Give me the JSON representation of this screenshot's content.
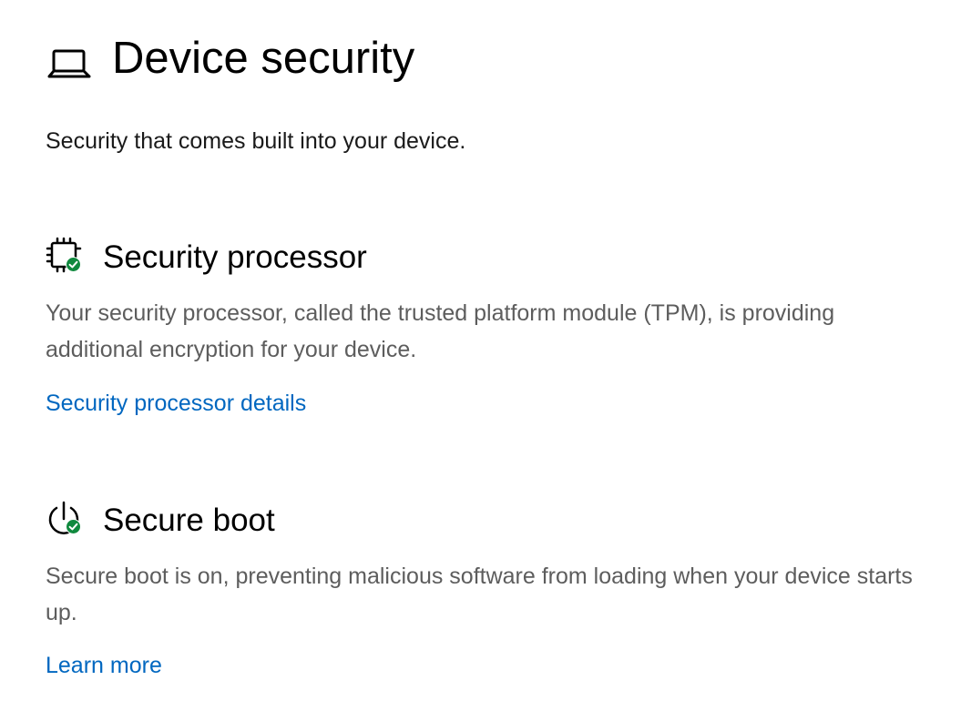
{
  "page": {
    "title": "Device security",
    "subtitle": "Security that comes built into your device.",
    "title_icon": "laptop-icon"
  },
  "sections": [
    {
      "title": "Security processor",
      "icon": "processor-chip-icon",
      "status_icon": "green-check-icon",
      "description": "Your security processor, called the trusted platform module (TPM), is providing additional encryption for your device.",
      "link": "Security processor details"
    },
    {
      "title": "Secure boot",
      "icon": "power-icon",
      "status_icon": "green-check-icon",
      "description": "Secure boot is on, preventing malicious software from loading when your device starts up.",
      "link": "Learn more"
    }
  ],
  "colors": {
    "status_ok": "#10893e",
    "link": "#0067c0",
    "secondary_text": "#5d5d5d"
  }
}
